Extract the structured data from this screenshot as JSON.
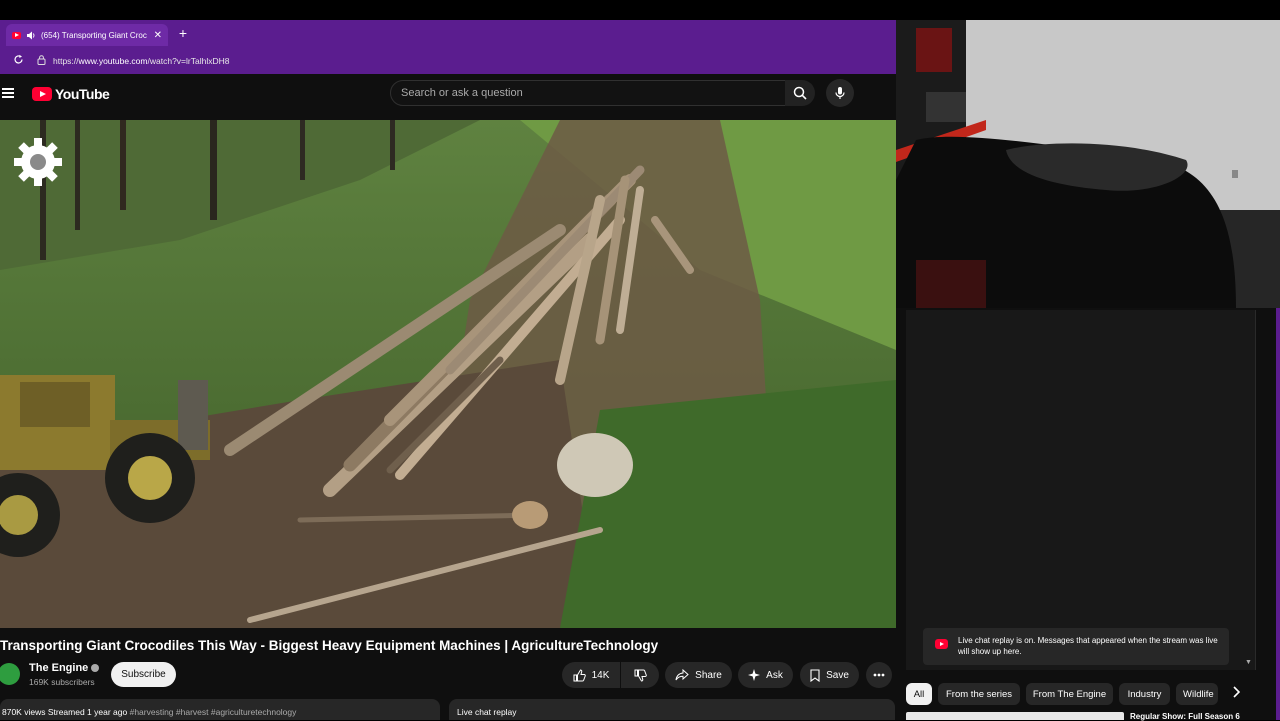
{
  "browser": {
    "tab_title": "(654) Transporting Giant Croc",
    "tab_close": "✕",
    "new_tab": "+",
    "url_prefix": "https://",
    "url_host": "www.youtube.com",
    "url_path": "/watch?v=lrTalhlxDH8"
  },
  "header": {
    "logo_text": "YouTube",
    "search_placeholder": "Search or ask a question"
  },
  "video": {
    "title": "Transporting Giant Crocodiles This Way - Biggest Heavy Equipment Machines | AgricultureTechnology",
    "channel_name": "The Engine",
    "subscribers": "169K subscribers",
    "subscribe_label": "Subscribe",
    "like_count": "14K",
    "share_label": "Share",
    "ask_label": "Ask",
    "save_label": "Save",
    "description_meta": "870K views  Streamed 1 year ago",
    "description_tags": "#harvesting #harvest #agriculturetechnology",
    "live_chat_replay_label": "Live chat replay"
  },
  "chat": {
    "notice": "Live chat replay is on. Messages that appeared when the stream was live will show up here."
  },
  "chips": [
    "All",
    "From the series",
    "From The Engine",
    "Industry",
    "Wildlife"
  ],
  "up_next_title": "Regular Show: Full Season 6",
  "colors": {
    "browser_purple": "#5b1d8f",
    "youtube_red": "#ff0033",
    "page_bg": "#0f0f0f"
  }
}
